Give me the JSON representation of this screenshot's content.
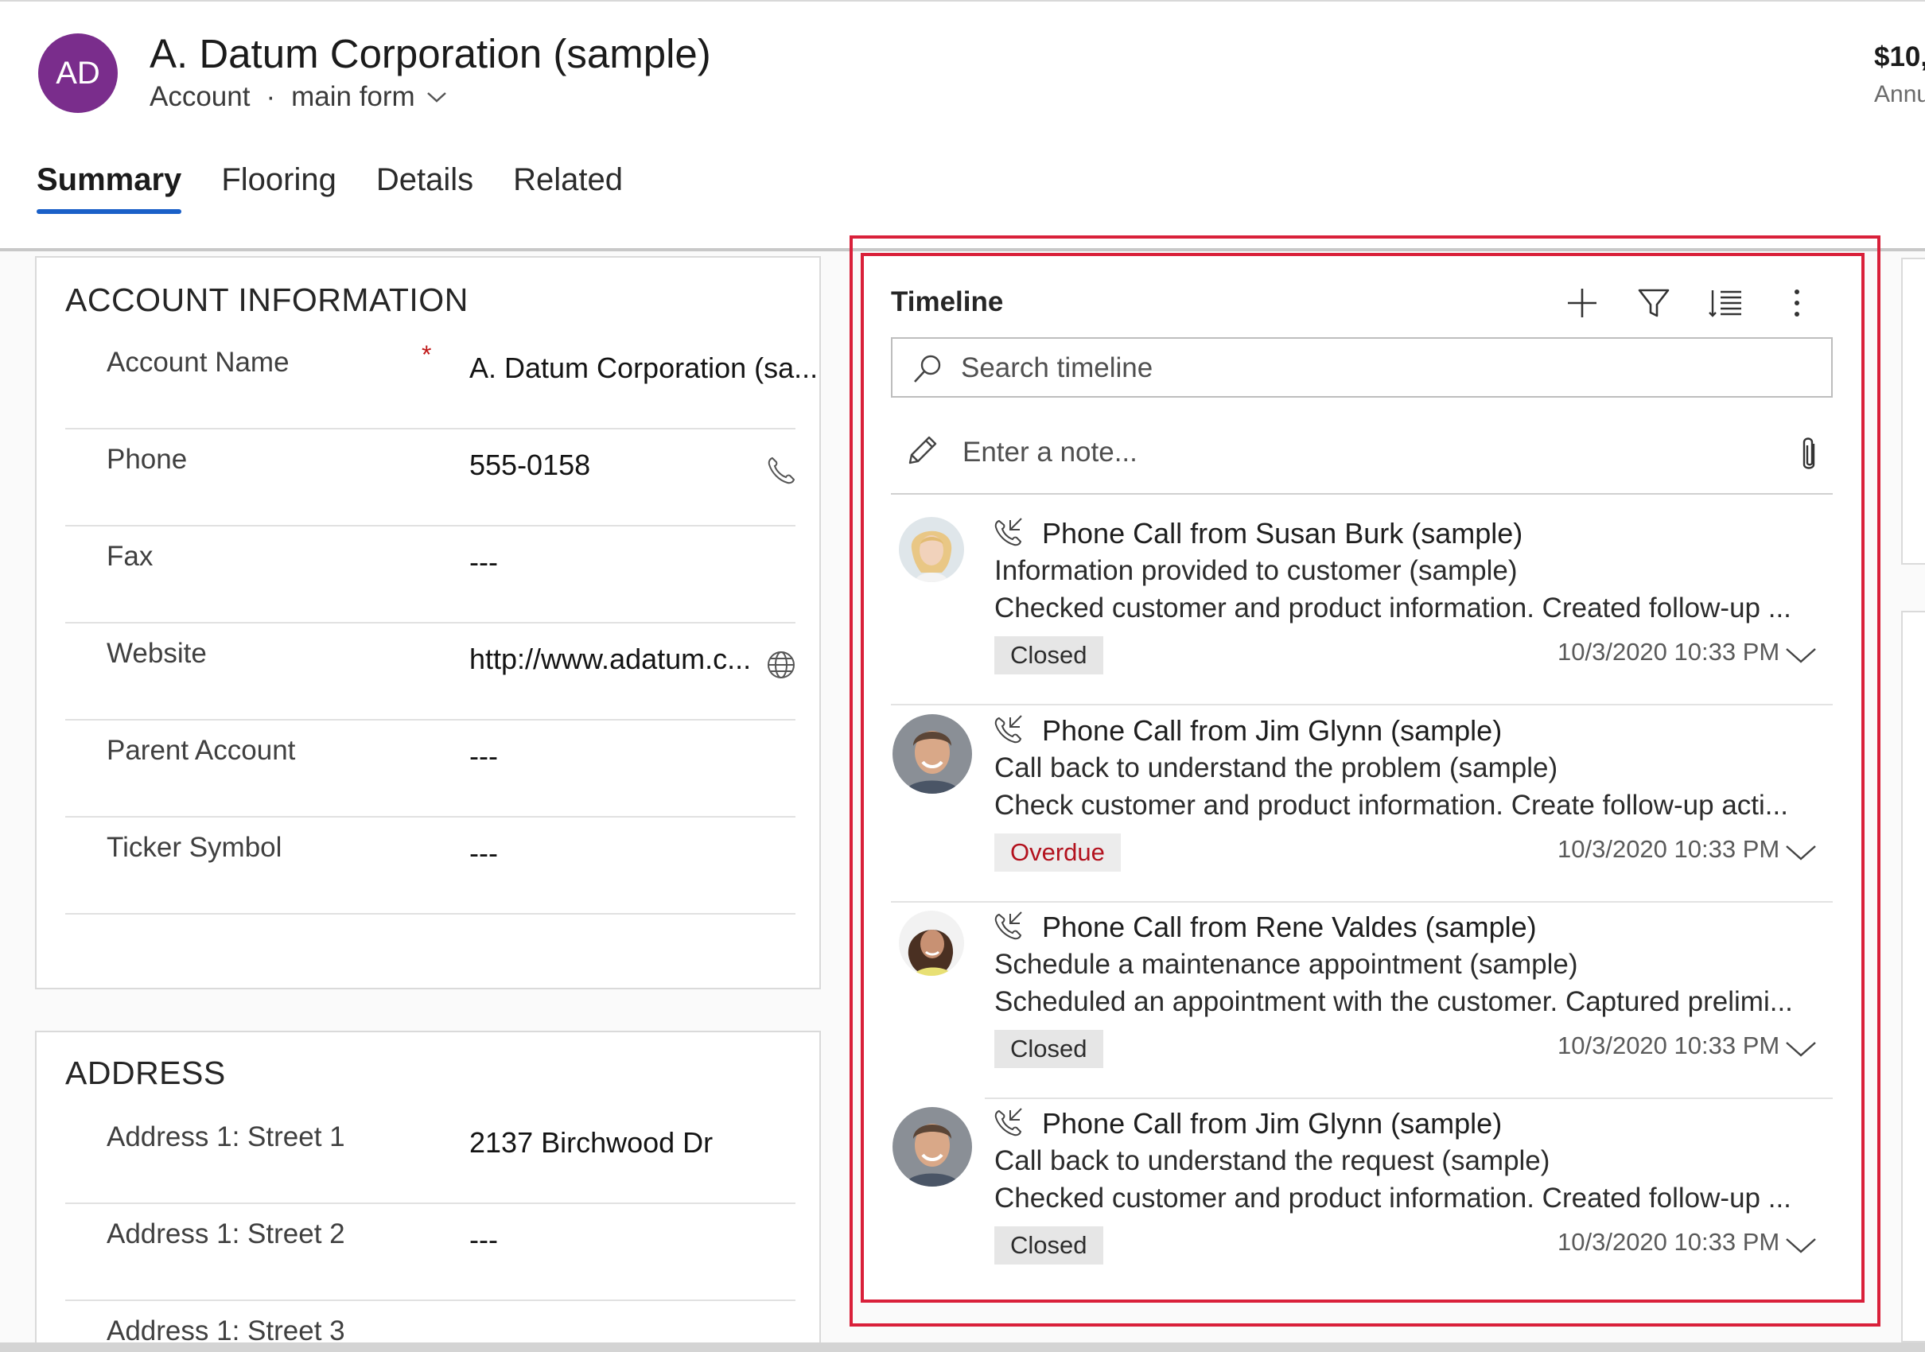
{
  "record": {
    "initials": "AD",
    "title": "A. Datum Corporation (sample)",
    "entity": "Account",
    "separator": "·",
    "form": "main form",
    "header_value": "$10,",
    "header_value_label": "Annu"
  },
  "tabs": [
    {
      "label": "Summary",
      "active": true
    },
    {
      "label": "Flooring",
      "active": false
    },
    {
      "label": "Details",
      "active": false
    },
    {
      "label": "Related",
      "active": false
    }
  ],
  "account_information": {
    "title": "ACCOUNT INFORMATION",
    "fields": [
      {
        "label": "Account Name",
        "required": "*",
        "value": "A. Datum Corporation (sa...",
        "icon": null
      },
      {
        "label": "Phone",
        "value": "555-0158",
        "icon": "phone-icon"
      },
      {
        "label": "Fax",
        "value": "---",
        "icon": null
      },
      {
        "label": "Website",
        "value": "http://www.adatum.c...",
        "icon": "globe-icon"
      },
      {
        "label": "Parent Account",
        "value": "---",
        "icon": null
      },
      {
        "label": "Ticker Symbol",
        "value": "---",
        "icon": null
      }
    ]
  },
  "address": {
    "title": "ADDRESS",
    "fields": [
      {
        "label": "Address 1: Street 1",
        "value": "2137 Birchwood Dr"
      },
      {
        "label": "Address 1: Street 2",
        "value": "---"
      },
      {
        "label": "Address 1: Street 3",
        "value": ""
      }
    ]
  },
  "timeline": {
    "title": "Timeline",
    "toolbar": [
      "add-icon",
      "filter-icon",
      "sort-list-icon",
      "more-vertical-icon"
    ],
    "search_placeholder": "Search timeline",
    "note_placeholder": "Enter a note...",
    "items": [
      {
        "title": "Phone Call from Susan Burk (sample)",
        "subject": "Information provided to customer (sample)",
        "description": "Checked customer and product information. Created follow-up ...",
        "status": "Closed",
        "date": "10/3/2020 10:33 PM",
        "avatar": "avatar-susan"
      },
      {
        "title": "Phone Call from Jim Glynn (sample)",
        "subject": "Call back to understand the problem (sample)",
        "description": "Check customer and product information. Create follow-up acti...",
        "status": "Overdue",
        "date": "10/3/2020 10:33 PM",
        "avatar": "avatar-jim"
      },
      {
        "title": "Phone Call from Rene Valdes (sample)",
        "subject": "Schedule a maintenance appointment (sample)",
        "description": "Scheduled an appointment with the customer. Captured prelimi...",
        "status": "Closed",
        "date": "10/3/2020 10:33 PM",
        "avatar": "avatar-rene"
      },
      {
        "title": "Phone Call from Jim Glynn (sample)",
        "subject": "Call back to understand the request (sample)",
        "description": "Checked customer and product information. Created follow-up ...",
        "status": "Closed",
        "date": "10/3/2020 10:33 PM",
        "avatar": "avatar-jim"
      }
    ]
  },
  "colors": {
    "avatar_bg": "#7a2d8c",
    "tab_underline": "#1a60c8",
    "highlight_border": "#d9203a",
    "required_star": "#c01818",
    "overdue_text": "#b3121e"
  }
}
